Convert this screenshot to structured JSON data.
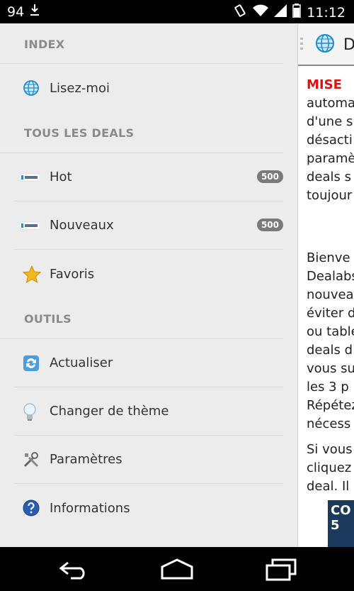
{
  "status_bar": {
    "notification_count": "94",
    "time": "11:12"
  },
  "drawer": {
    "sections": [
      {
        "title": "INDEX",
        "items": [
          {
            "label": "Lisez-moi",
            "icon": "globe-icon",
            "badge": ""
          }
        ]
      },
      {
        "title": "TOUS LES DEALS",
        "items": [
          {
            "label": "Hot",
            "icon": "dealabs-logo-icon",
            "badge": "500"
          },
          {
            "label": "Nouveaux",
            "icon": "dealabs-logo-icon",
            "badge": "500"
          },
          {
            "label": "Favoris",
            "icon": "star-icon",
            "badge": ""
          }
        ]
      },
      {
        "title": "OUTILS",
        "items": [
          {
            "label": "Actualiser",
            "icon": "refresh-icon",
            "badge": ""
          },
          {
            "label": "Changer de thème",
            "icon": "lightbulb-icon",
            "badge": ""
          },
          {
            "label": "Paramètres",
            "icon": "tools-icon",
            "badge": ""
          },
          {
            "label": "Informations",
            "icon": "help-icon",
            "badge": ""
          }
        ]
      }
    ]
  },
  "content": {
    "title": "D",
    "paragraphs": [
      [
        "MISE",
        "automa",
        "d'une s",
        "désacti",
        "paramè",
        "deals s",
        "toujour"
      ],
      [
        "Bienve",
        "Dealabs",
        "nouvea",
        "éviter d",
        "ou table",
        "deals d",
        "vous su",
        "les 3 p",
        "Répétez",
        "nécess"
      ],
      [
        "Si vous",
        "cliquez",
        "deal. Il"
      ]
    ],
    "ad_text": "CO\n5"
  },
  "colors": {
    "drawer_bg": "#ececec",
    "section_header": "#8a8a8a",
    "badge_bg": "#7a7a7a",
    "accent_red": "#e01010"
  }
}
